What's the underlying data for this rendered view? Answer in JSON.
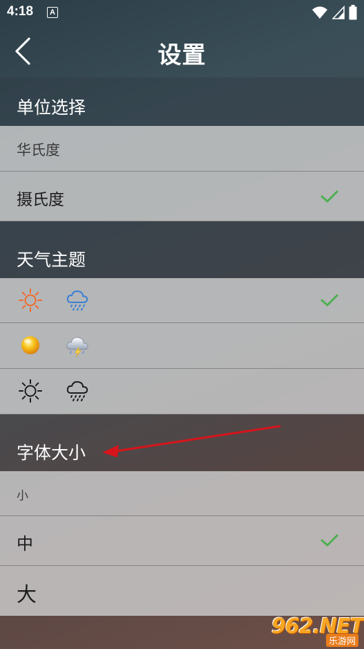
{
  "status_bar": {
    "time": "4:18",
    "notification_icon_letter": "A",
    "icons": [
      "wifi-icon",
      "cellular-signal-icon",
      "battery-icon"
    ]
  },
  "header": {
    "title": "设置",
    "back_icon": "chevron-left-icon"
  },
  "sections": {
    "unit": {
      "title": "单位选择",
      "options": [
        {
          "label": "华氏度",
          "selected": false
        },
        {
          "label": "摄氏度",
          "selected": true
        }
      ]
    },
    "theme": {
      "title": "天气主题",
      "options": [
        {
          "icons": [
            "sun-outline-orange-icon",
            "rain-cloud-blue-icon"
          ],
          "selected": true
        },
        {
          "icons": [
            "sun-glossy-icon",
            "cloud-lightning-glossy-icon"
          ],
          "selected": false
        },
        {
          "icons": [
            "sun-outline-black-icon",
            "rain-cloud-black-icon"
          ],
          "selected": false
        }
      ]
    },
    "font_size": {
      "title": "字体大小",
      "options": [
        {
          "label": "小",
          "selected": false
        },
        {
          "label": "中",
          "selected": true
        },
        {
          "label": "大",
          "selected": false
        }
      ]
    }
  },
  "annotation": {
    "icon": "red-arrow-icon"
  },
  "watermark": {
    "brand": "962.NET",
    "subtitle": "乐游网"
  },
  "colors": {
    "check": "#4caf50",
    "orange_icon": "#f26a2b",
    "blue_icon": "#3a7fd5",
    "arrow": "#d8141b",
    "watermark": "#f6a623"
  }
}
